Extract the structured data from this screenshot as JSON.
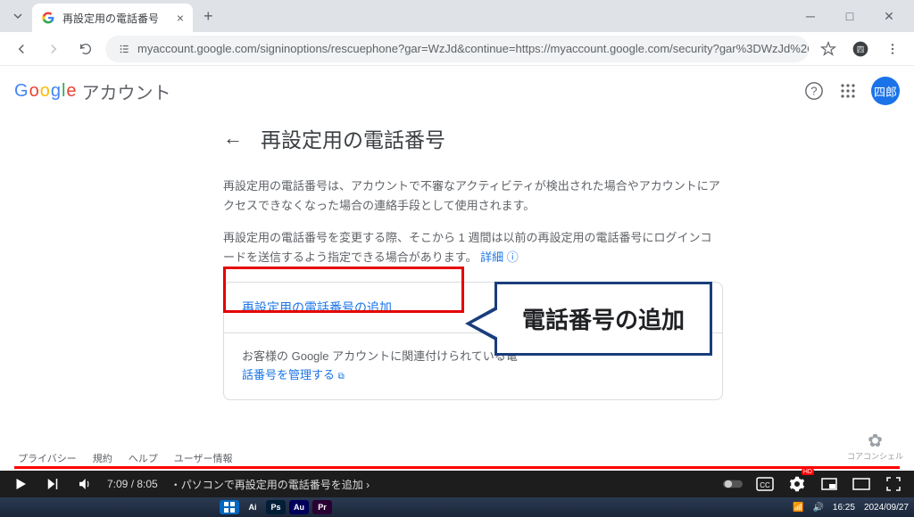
{
  "browser": {
    "tab_title": "再設定用の電話番号",
    "url": "myaccount.google.com/signinoptions/rescuephone?gar=WzJd&continue=https://myaccount.google.com/security?gar%3DWzJd%26hl%3Dja%26utm_source%...",
    "new_tab": "+",
    "close_tab": "×"
  },
  "header": {
    "logo_chars": [
      "G",
      "o",
      "o",
      "g",
      "l",
      "e"
    ],
    "product": "アカウント",
    "avatar_text": "四郎"
  },
  "page": {
    "title": "再設定用の電話番号",
    "desc1": "再設定用の電話番号は、アカウントで不審なアクティビティが検出された場合やアカウントにアクセスできなくなった場合の連絡手段として使用されます。",
    "desc2": "再設定用の電話番号を変更する際、そこから 1 週間は以前の再設定用の電話番号にログインコードを送信するよう指定できる場合があります。",
    "details_link": "詳細",
    "add_phone": "再設定用の電話番号の追加",
    "related_text": "お客様の Google アカウントに関連付けられている電",
    "manage_link": "話番号を管理する"
  },
  "callout": {
    "text": "電話番号の追加"
  },
  "footer": {
    "privacy": "プライバシー",
    "terms": "規約",
    "help": "ヘルプ",
    "userinfo": "ユーザー情報"
  },
  "watermark": {
    "label": "コアコンシェル"
  },
  "video": {
    "current": "7:09",
    "total": "8:05",
    "chapter_sep": "・",
    "chapter": "パソコンで再設定用の電話番号を追加",
    "chev": "›"
  },
  "taskbar": {
    "time": "16:25",
    "date": "2024/09/27",
    "apps": [
      {
        "bg": "#330000",
        "txt": "Ai"
      },
      {
        "bg": "#001e36",
        "txt": "Ps"
      },
      {
        "bg": "#00005b",
        "txt": "Au"
      },
      {
        "bg": "#2a0033",
        "txt": "Pr"
      }
    ]
  }
}
